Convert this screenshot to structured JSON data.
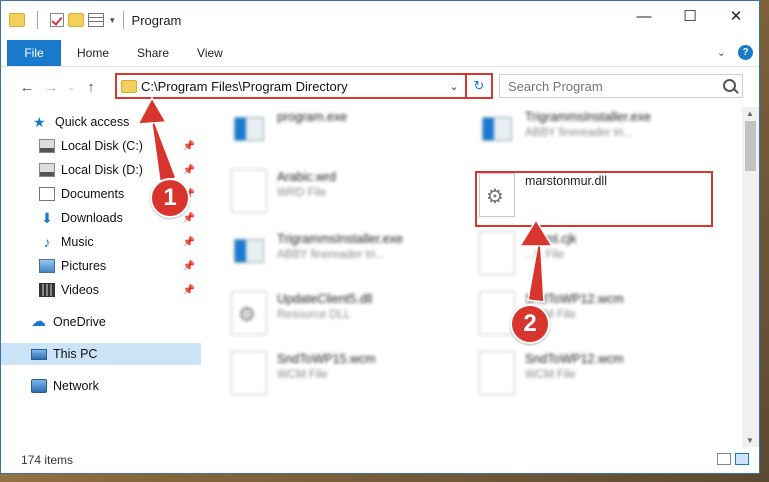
{
  "window": {
    "title": "Program"
  },
  "ribbon": {
    "tabs": [
      "File",
      "Home",
      "Share",
      "View"
    ]
  },
  "address": {
    "path": "C:\\Program Files\\Program Directory"
  },
  "search": {
    "placeholder": "Search Program"
  },
  "sidebar": {
    "items": [
      {
        "label": "Quick access",
        "icon": "star-icon"
      },
      {
        "label": "Local Disk (C:)",
        "icon": "drive-icon"
      },
      {
        "label": "Local Disk (D:)",
        "icon": "drive-icon"
      },
      {
        "label": "Documents",
        "icon": "documents-icon"
      },
      {
        "label": "Downloads",
        "icon": "download-icon"
      },
      {
        "label": "Music",
        "icon": "music-icon"
      },
      {
        "label": "Pictures",
        "icon": "pictures-icon"
      },
      {
        "label": "Videos",
        "icon": "videos-icon"
      },
      {
        "label": "OneDrive",
        "icon": "cloud-icon"
      },
      {
        "label": "This PC",
        "icon": "computer-icon"
      },
      {
        "label": "Network",
        "icon": "network-icon"
      }
    ]
  },
  "files": [
    {
      "name": "program.exe",
      "type": ""
    },
    {
      "name": "TrigrammsInstaller.exe",
      "type": "ABBY finereader tri..."
    },
    {
      "name": "Arabic.wrd",
      "type": "WRD File"
    },
    {
      "name": "marstonmur.dll",
      "type": ""
    },
    {
      "name": "TrigrammsInstaller.exe",
      "type": "ABBY finereader tri..."
    },
    {
      "name": "...Nml.cjk",
      "type": "...K File"
    },
    {
      "name": "UpdateClient5.dll",
      "type": "Resource DLL"
    },
    {
      "name": "SndToWP12.wcm",
      "type": "WCM File"
    },
    {
      "name": "SndToWP15.wcm",
      "type": "WCM File"
    },
    {
      "name": "SndToWP12.wcm",
      "type": "WCM File"
    }
  ],
  "status": {
    "text": "174 items"
  },
  "callouts": [
    "1",
    "2"
  ],
  "colors": {
    "accent": "#1979ca",
    "highlight": "#d9352f",
    "selected": "#cce4f7"
  }
}
